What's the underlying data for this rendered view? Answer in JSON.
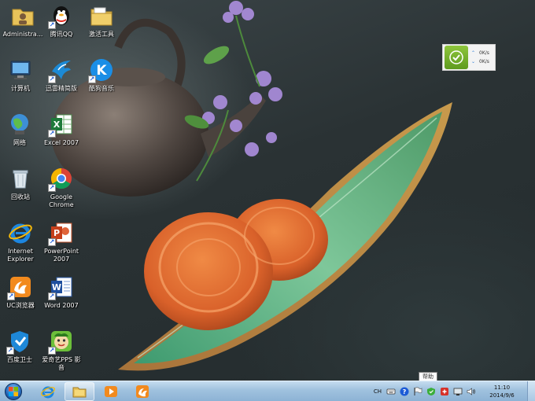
{
  "desktop_icons": [
    {
      "key": "administrator",
      "label": "Administra...",
      "icon": "user-folder-icon",
      "shortcut": false
    },
    {
      "key": "computer",
      "label": "计算机",
      "icon": "computer-icon",
      "shortcut": false
    },
    {
      "key": "network",
      "label": "网络",
      "icon": "network-icon",
      "shortcut": false
    },
    {
      "key": "recycle-bin",
      "label": "回收站",
      "icon": "recycle-bin-icon",
      "shortcut": false
    },
    {
      "key": "ie",
      "label": "Internet\nExplorer",
      "icon": "internet-explorer-icon",
      "shortcut": false
    },
    {
      "key": "uc-browser",
      "label": "UC浏览器",
      "icon": "uc-browser-icon",
      "shortcut": true
    },
    {
      "key": "baidu-guard",
      "label": "百度卫士",
      "icon": "baidu-guard-icon",
      "shortcut": true
    },
    {
      "key": "tencent-qq",
      "label": "腾讯QQ",
      "icon": "qq-penguin-icon",
      "shortcut": true
    },
    {
      "key": "xunlei",
      "label": "迅雷精简版",
      "icon": "xunlei-bird-icon",
      "shortcut": true
    },
    {
      "key": "excel",
      "label": "Excel 2007",
      "icon": "excel-icon",
      "shortcut": true
    },
    {
      "key": "chrome",
      "label": "Google\nChrome",
      "icon": "chrome-icon",
      "shortcut": true
    },
    {
      "key": "powerpoint",
      "label": "PowerPoint\n2007",
      "icon": "powerpoint-icon",
      "shortcut": true
    },
    {
      "key": "word",
      "label": "Word 2007",
      "icon": "word-icon",
      "shortcut": true
    },
    {
      "key": "pps",
      "label": "爱奇艺PPS 影\n音",
      "icon": "pps-player-icon",
      "shortcut": true
    },
    {
      "key": "activation-tools",
      "label": "激活工具",
      "icon": "folder-icon",
      "shortcut": false
    },
    {
      "key": "kugou",
      "label": "酷狗音乐",
      "icon": "kugou-music-icon",
      "shortcut": true
    }
  ],
  "net_widget": {
    "up_rate": "0K/s",
    "down_rate": "0K/s",
    "status_icon": "checkmark-icon",
    "accent": "#6fae2a"
  },
  "tooltip": {
    "text": "帮助"
  },
  "taskbar": {
    "pinned": [
      {
        "key": "ie",
        "icon": "internet-explorer-icon"
      },
      {
        "key": "explorer",
        "icon": "file-explorer-icon"
      },
      {
        "key": "media-player",
        "icon": "media-player-icon"
      },
      {
        "key": "uc-browser",
        "icon": "uc-browser-icon"
      }
    ],
    "tray": {
      "language": "CH",
      "icons": [
        "keyboard-icon",
        "help-icon",
        "flag-icon",
        "security-shield-icon",
        "antivirus-icon",
        "network-icon",
        "volume-icon"
      ],
      "time": "11:10",
      "date": "2014/9/6"
    }
  },
  "colors": {
    "taskbar": "#9fc1de",
    "label_text": "#ffffff"
  }
}
